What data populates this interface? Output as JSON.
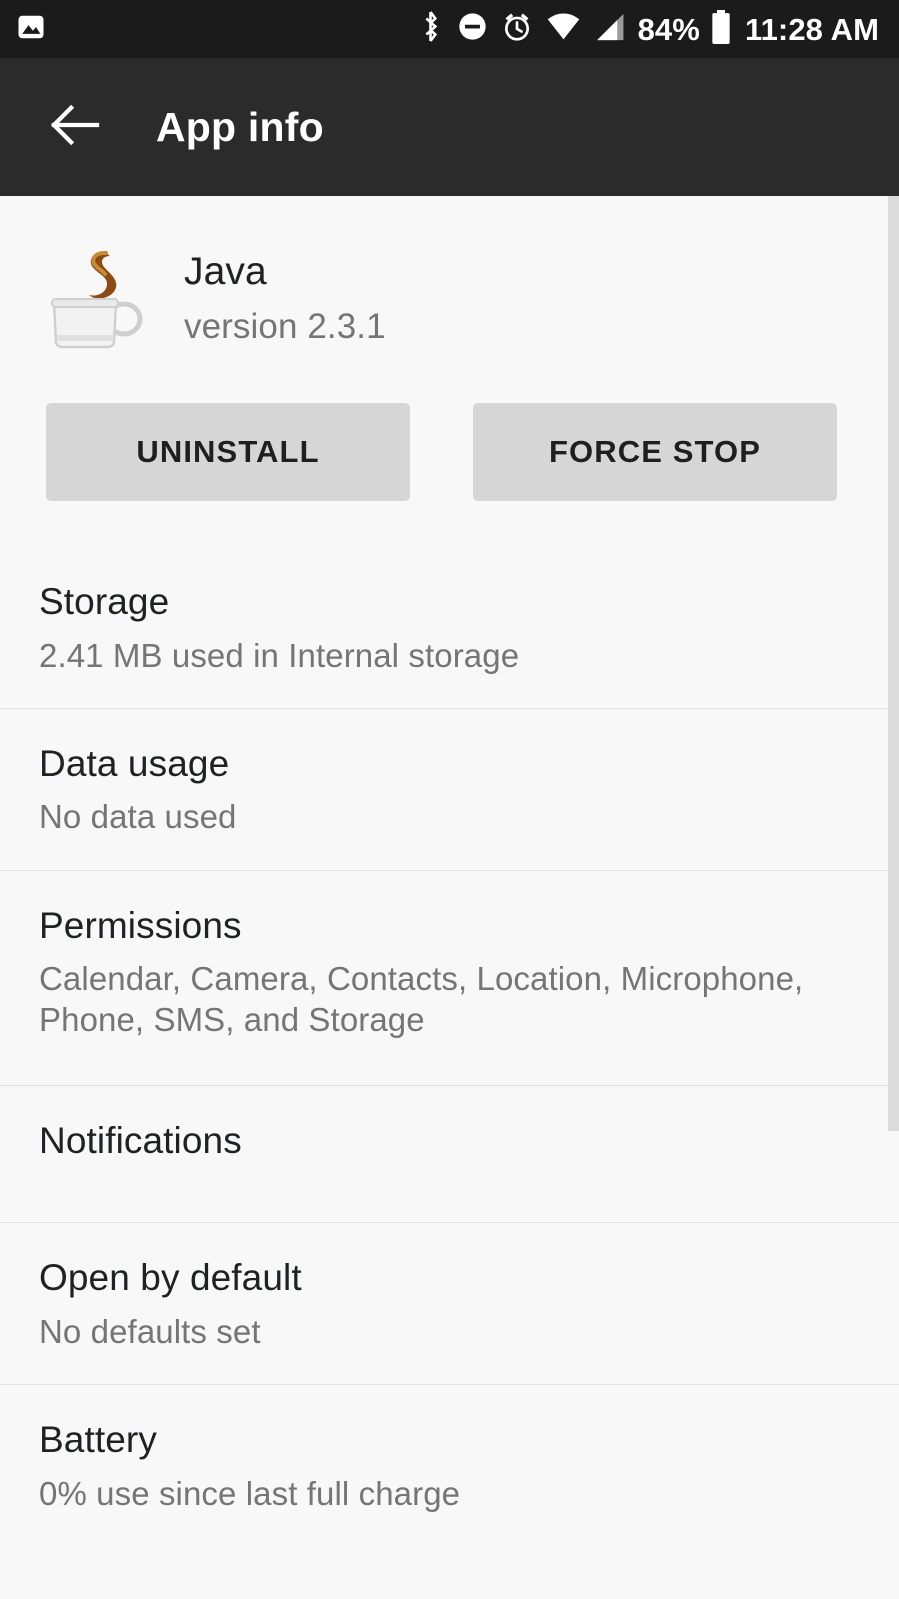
{
  "status_bar": {
    "notification_icon": "photo-icon",
    "icons": [
      "bluetooth-icon",
      "do-not-disturb-icon",
      "alarm-icon",
      "wifi-icon",
      "cellular-signal-icon"
    ],
    "battery_percent": "84%",
    "battery_icon": "battery-full-icon",
    "time": "11:28 AM",
    "background_color": "#1b1b1b",
    "foreground_color": "#ffffff"
  },
  "app_bar": {
    "back_icon": "back-arrow-icon",
    "title": "App info",
    "background_color": "#2b2b2b",
    "foreground_color": "#ffffff"
  },
  "app": {
    "icon": "java-coffee-cup-icon",
    "name": "Java",
    "version": "version 2.3.1"
  },
  "actions": {
    "uninstall_label": "UNINSTALL",
    "force_stop_label": "FORCE STOP",
    "button_color": "#d6d6d6"
  },
  "settings_rows": [
    {
      "title": "Storage",
      "subtitle": "2.41 MB used in Internal storage"
    },
    {
      "title": "Data usage",
      "subtitle": "No data used"
    },
    {
      "title": "Permissions",
      "subtitle": "Calendar, Camera, Contacts, Location, Microphone, Phone, SMS, and Storage"
    },
    {
      "title": "Notifications",
      "subtitle": ""
    },
    {
      "title": "Open by default",
      "subtitle": "No defaults set"
    },
    {
      "title": "Battery",
      "subtitle": "0% use since last full charge"
    }
  ],
  "colors": {
    "page_background": "#f8f8f8",
    "divider": "#e2e2e2",
    "primary_text": "#202124",
    "secondary_text": "#757575",
    "scrollbar": "#dcdcdc",
    "java_steam": "#8c4a15"
  }
}
